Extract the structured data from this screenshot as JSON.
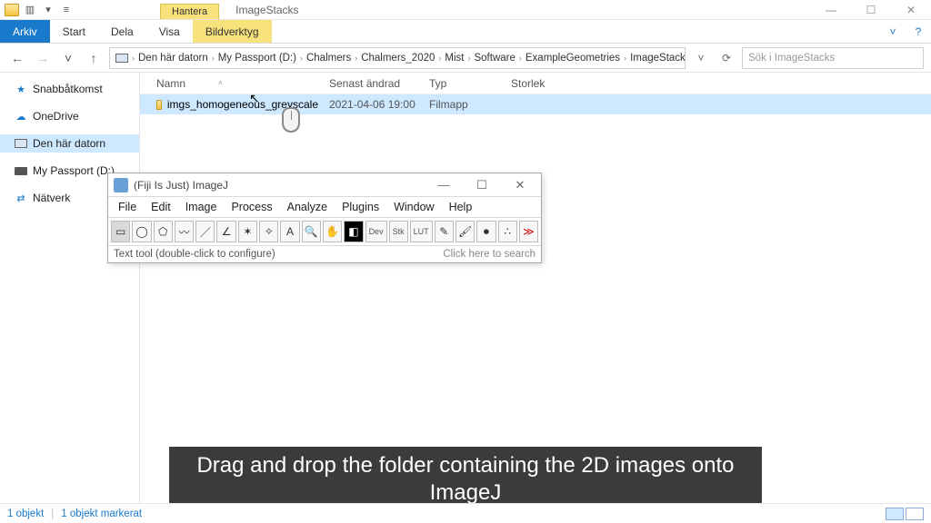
{
  "window": {
    "title": "ImageStacks",
    "context_tab": "Hantera",
    "context_subtab": "Bildverktyg",
    "controls": {
      "min": "—",
      "max": "☐",
      "close": "✕"
    }
  },
  "ribbon": {
    "tabs": {
      "arkiv": "Arkiv",
      "start": "Start",
      "dela": "Dela",
      "visa": "Visa",
      "bildverktyg": "Bildverktyg"
    },
    "help_caret": "˅"
  },
  "nav": {
    "back": "←",
    "fwd": "→",
    "up": "↑",
    "refresh": "⟳",
    "dropdown": "˅"
  },
  "breadcrumb": [
    "Den här datorn",
    "My Passport (D:)",
    "Chalmers",
    "Chalmers_2020",
    "Mist",
    "Software",
    "ExampleGeometries",
    "ImageStacks"
  ],
  "search": {
    "placeholder": "Sök i ImageStacks"
  },
  "sidebar": {
    "items": [
      {
        "label": "Snabbåtkomst",
        "icon": "star"
      },
      {
        "label": "OneDrive",
        "icon": "cloud"
      },
      {
        "label": "Den här datorn",
        "icon": "pc",
        "selected": true
      },
      {
        "label": "My Passport (D:)",
        "icon": "drive"
      },
      {
        "label": "Nätverk",
        "icon": "net"
      }
    ]
  },
  "columns": {
    "name": "Namn",
    "modified": "Senast ändrad",
    "type": "Typ",
    "size": "Storlek"
  },
  "rows": [
    {
      "name": "imgs_homogeneous_greyscale",
      "modified": "2021-04-06 19:00",
      "type": "Filmapp",
      "size": "",
      "selected": true
    }
  ],
  "statusbar": {
    "count": "1 objekt",
    "selected": "1 objekt markerat"
  },
  "imagej": {
    "title": "(Fiji Is Just) ImageJ",
    "menu": [
      "File",
      "Edit",
      "Image",
      "Process",
      "Analyze",
      "Plugins",
      "Window",
      "Help"
    ],
    "tool_labels": {
      "dev": "Dev",
      "stk": "Stk",
      "lut": "LUT"
    },
    "status_left": "Text tool (double-click to configure)",
    "status_right": "Click here to search",
    "controls": {
      "min": "—",
      "max": "☐",
      "close": "✕"
    }
  },
  "caption": "Drag and drop the folder containing the 2D images onto ImageJ"
}
